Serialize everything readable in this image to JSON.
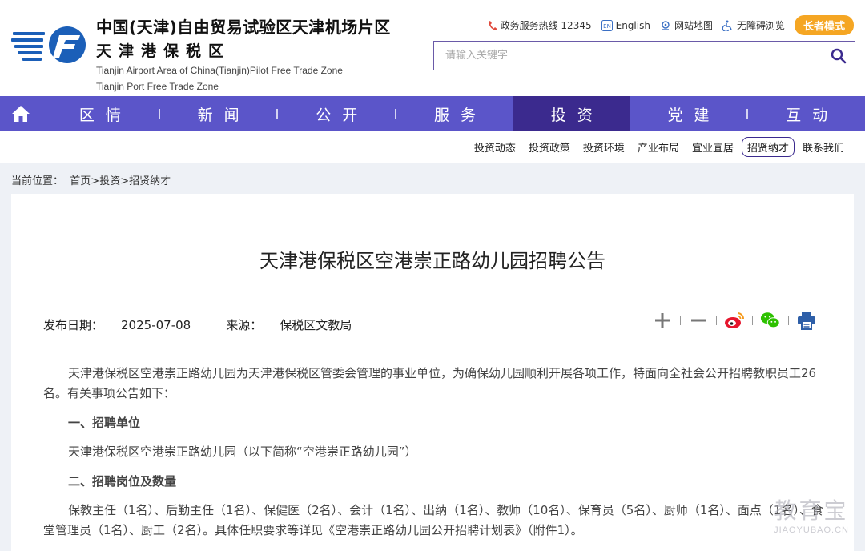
{
  "header": {
    "title_cn": "中国(天津)自由贸易试验区天津机场片区",
    "subtitle_cn": "天津港保税区",
    "title_en_1": "Tianjin Airport Area of China(Tianjin)Pilot Free Trade Zone",
    "title_en_2": "Tianjin Port Free Trade Zone",
    "hotline": "政务服务热线 12345",
    "english": "English",
    "sitemap": "网站地图",
    "accessible": "无障碍浏览",
    "elder_mode": "长者模式",
    "search_placeholder": "请输入关键字"
  },
  "nav": {
    "items": [
      {
        "label": "区情",
        "active": false
      },
      {
        "label": "新闻",
        "active": false
      },
      {
        "label": "公开",
        "active": false
      },
      {
        "label": "服务",
        "active": false
      },
      {
        "label": "投资",
        "active": true
      },
      {
        "label": "党建",
        "active": false
      },
      {
        "label": "互动",
        "active": false
      }
    ]
  },
  "subnav": {
    "items": [
      "投资动态",
      "投资政策",
      "投资环境",
      "产业布局",
      "宜业宜居",
      "招贤纳才",
      "联系我们"
    ],
    "active_index": 5
  },
  "breadcrumb": {
    "prefix": "当前位置：",
    "home": "首页",
    "sep1": ">",
    "level1": "投资",
    "sep2": ">",
    "level2": "招贤纳才"
  },
  "article": {
    "title": "天津港保税区空港崇正路幼儿园招聘公告",
    "date_label": "发布日期：",
    "date": "2025-07-08",
    "source_label": "来源：",
    "source": "保税区文教局",
    "intro": "天津港保税区空港崇正路幼儿园为天津港保税区管委会管理的事业单位，为确保幼儿园顺利开展各项工作，特面向全社会公开招聘教职员工26名。有关事项公告如下：",
    "section1_heading": "一、招聘单位",
    "section1_text": "天津港保税区空港崇正路幼儿园（以下简称“空港崇正路幼儿园”）",
    "section2_heading": "二、招聘岗位及数量",
    "section2_text": "保教主任（1名）、后勤主任（1名）、保健医（2名）、会计（1名）、出纳（1名）、教师（10名）、保育员（5名）、厨师（1名）、面点（1名）、食堂管理员（1名）、厨工（2名）。具体任职要求等详见《空港崇正路幼儿园公开招聘计划表》（附件1）。"
  },
  "watermark": {
    "cn": "教育宝",
    "en": "JIAOYUBAO.CN"
  },
  "colors": {
    "nav_bg": "#5b55c9",
    "nav_active": "#3b2a8e",
    "elder_btn": "#f5a623",
    "logo_blue": "#1b5fb8"
  }
}
